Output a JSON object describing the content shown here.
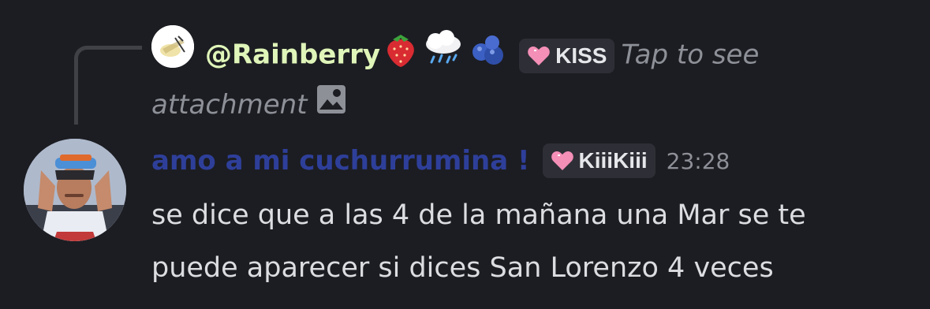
{
  "reply": {
    "author": "@Rainberry",
    "author_emojis": [
      "strawberry-emoji",
      "cloud-rain-emoji",
      "blueberries-emoji"
    ],
    "tag_label": "KISS",
    "preview_text": "Tap to see attachment"
  },
  "message": {
    "author": "amo a mi cuchurrumina !",
    "tag_label": "KiiiKiii",
    "timestamp": "23:28",
    "lines": [
      "se dice que a las 4 de la mañana una Mar se te",
      "puede aparecer si dices San Lorenzo 4 veces"
    ]
  },
  "colors": {
    "background": "#1c1d22",
    "reply_author": "#dff5b9",
    "message_author": "#2e3f9a",
    "muted_text": "#8e9098",
    "tag_background": "#2e2f36",
    "heart": "#f48fb8"
  },
  "icons": {
    "tag_icon": "pink-heart-icon",
    "attachment_icon": "image-icon"
  }
}
